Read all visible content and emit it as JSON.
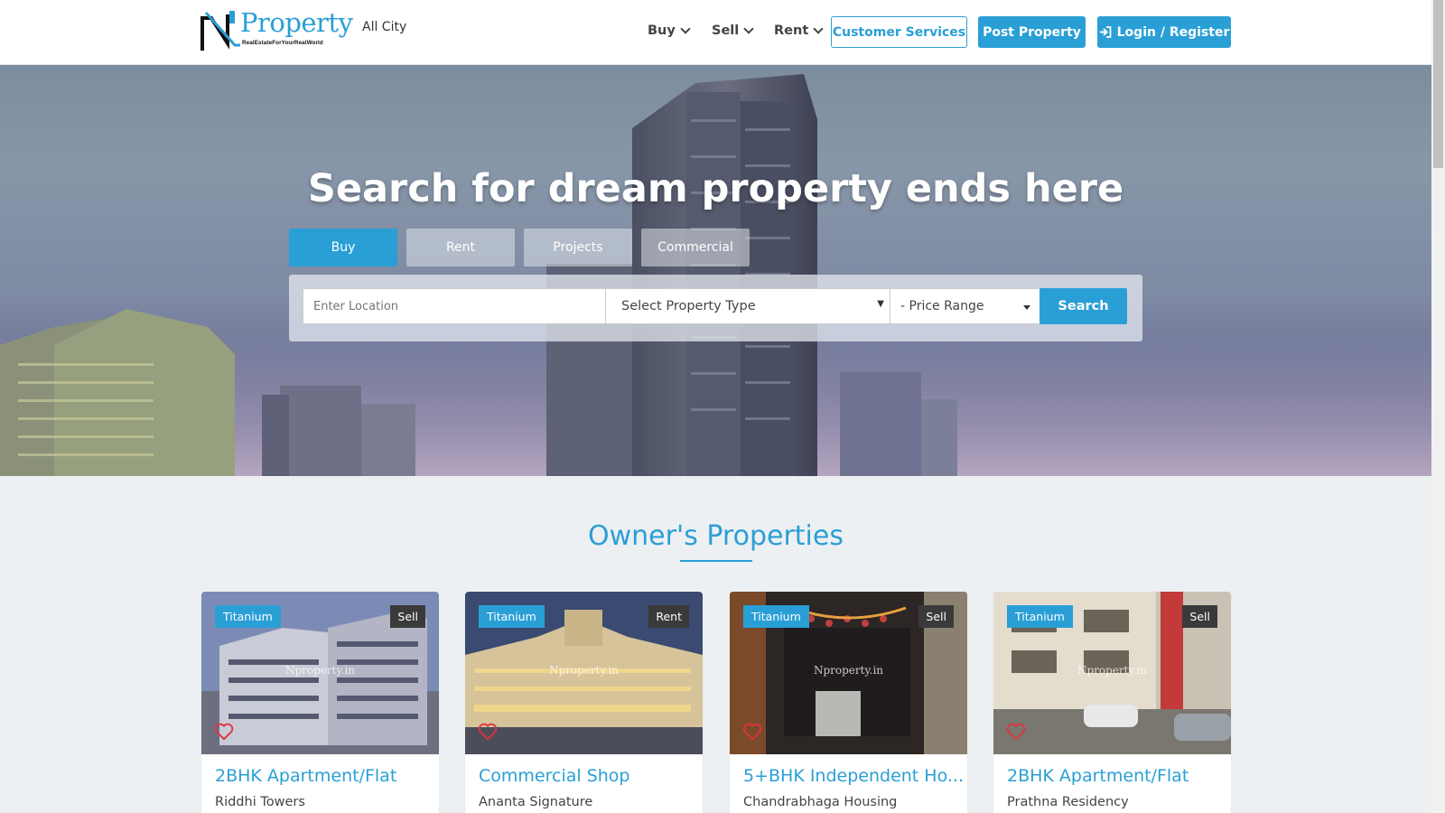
{
  "header": {
    "logo_text": "Property",
    "logo_tagline": "RealEstateForYourRealWorld",
    "city": "All City",
    "nav": [
      {
        "label": "Buy"
      },
      {
        "label": "Sell"
      },
      {
        "label": "Rent"
      }
    ],
    "customer_services": "Customer Services",
    "post_property": "Post Property",
    "login": "Login / Register"
  },
  "hero": {
    "title": "Search for dream property ends here",
    "tabs": [
      "Buy",
      "Rent",
      "Projects",
      "Commercial"
    ],
    "active_tab": "Buy",
    "search": {
      "location_placeholder": "Enter Location",
      "property_type": "Select Property Type",
      "price_range": "- Price Range",
      "button": "Search"
    }
  },
  "section": {
    "title": "Owner's Properties"
  },
  "properties": [
    {
      "tier": "Titanium",
      "type": "Sell",
      "title": "2BHK Apartment/Flat",
      "project": "Riddhi Towers",
      "watermark": "Nproperty.in"
    },
    {
      "tier": "Titanium",
      "type": "Rent",
      "title": "Commercial Shop",
      "project": "Ananta Signature",
      "watermark": "Nproperty.in"
    },
    {
      "tier": "Titanium",
      "type": "Sell",
      "title": "5+BHK Independent Ho...",
      "project": "Chandrabhaga Housing",
      "watermark": "Nproperty.in"
    },
    {
      "tier": "Titanium",
      "type": "Sell",
      "title": "2BHK Apartment/Flat",
      "project": "Prathna Residency",
      "watermark": "Nproperty.in"
    }
  ],
  "colors": {
    "accent": "#2a9fd6",
    "dark_badge": "#3a3a3a",
    "heart": "#e0323c",
    "page_bg": "#edf0f3"
  },
  "icons": {
    "nav_chevron": "chevron-down-icon",
    "login": "sign-in-icon",
    "favorite": "heart-outline-icon"
  }
}
